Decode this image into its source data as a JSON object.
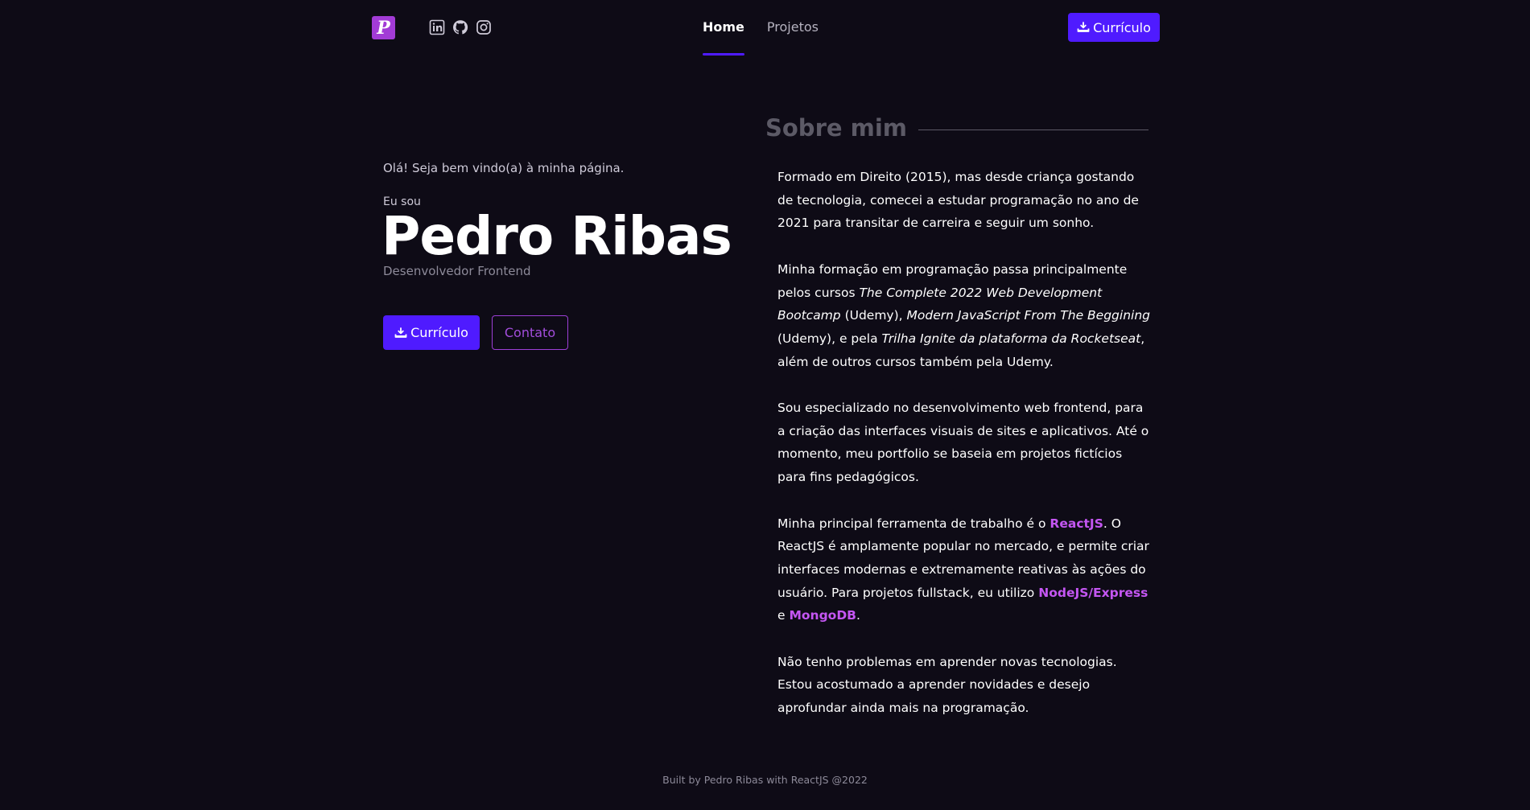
{
  "header": {
    "logo_letter": "P",
    "socials": [
      {
        "icon": "linkedin-icon"
      },
      {
        "icon": "github-icon"
      },
      {
        "icon": "instagram-icon"
      }
    ],
    "nav": [
      {
        "label": "Home",
        "active": true
      },
      {
        "label": "Projetos",
        "active": false
      }
    ],
    "cta_label": "Currículo"
  },
  "hero": {
    "greeting": "Olá! Seja bem vindo(a) à minha página.",
    "intro": "Eu sou",
    "name": "Pedro Ribas",
    "role": "Desenvolvedor Frontend",
    "cta_label": "Currículo",
    "contact_label": "Contato"
  },
  "about": {
    "title": "Sobre mim",
    "p1": "Formado em Direito (2015), mas desde criança gostando de tecnologia, comecei a estudar programação no ano de 2021 para transitar de carreira e seguir um sonho.",
    "p2": {
      "a": "Minha formação em programação passa principalmente pelos cursos ",
      "b": "The Complete 2022 Web Development Bootcamp",
      "c": " (Udemy), ",
      "d": "Modern JavaScript From The Beggining",
      "e": " (Udemy), e pela ",
      "f": "Trilha Ignite da plataforma da Rocketseat",
      "g": ", além de outros cursos também pela Udemy."
    },
    "p3": "Sou especializado no desenvolvimento web frontend, para a criação das interfaces visuais de sites e aplicativos. Até o momento, meu portfolio se baseia em projetos fictícios para fins pedagógicos.",
    "p4": {
      "a": "Minha principal ferramenta de trabalho é o ",
      "b": "ReactJS",
      "c": ". O ReactJS é amplamente popular no mercado, e permite criar interfaces modernas e extremamente reativas às ações do usuário. Para projetos fullstack, eu utilizo ",
      "d": "NodeJS/Express",
      "e": " e ",
      "f": "MongoDB",
      "g": "."
    },
    "p5": "Não tenho problemas em aprender novas tecnologias. Estou acostumado a aprender novidades e desejo aprofundar ainda mais na programação."
  },
  "footer": "Built by Pedro Ribas with ReactJS @2022",
  "colors": {
    "background": "#0e0b16",
    "accent": "#4f1bff",
    "logo": "#a23bd6",
    "highlight": "#c456f2"
  }
}
